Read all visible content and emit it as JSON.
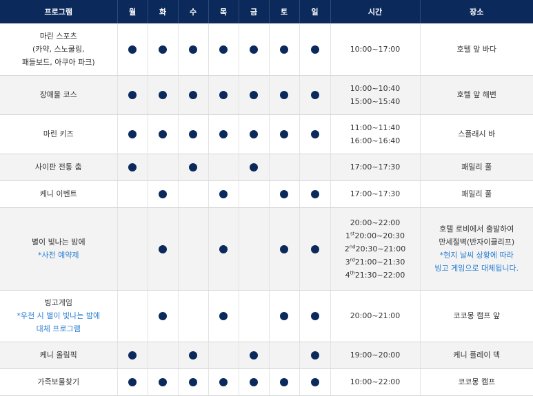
{
  "headers": {
    "program": "프로그램",
    "days": [
      "월",
      "화",
      "수",
      "목",
      "금",
      "토",
      "일"
    ],
    "time": "시간",
    "location": "장소"
  },
  "colors": {
    "header_bg": "#0b2a5b",
    "dot": "#0b2a5b",
    "note": "#2a7fd3",
    "alt_row": "#f3f3f3"
  },
  "rows": [
    {
      "program": [
        "마린 스포츠",
        "(카약, 스노쿨링,",
        "패들보드, 아쿠아 파크)"
      ],
      "program_note": [],
      "days": [
        true,
        true,
        true,
        true,
        true,
        true,
        true
      ],
      "times": [
        {
          "sup": "",
          "text": "10:00~17:00"
        }
      ],
      "location": [
        "호텔 앞 바다"
      ],
      "location_note": []
    },
    {
      "program": [
        "장애물 코스"
      ],
      "program_note": [],
      "days": [
        true,
        true,
        true,
        true,
        true,
        true,
        true
      ],
      "times": [
        {
          "sup": "",
          "text": "10:00~10:40"
        },
        {
          "sup": "",
          "text": "15:00~15:40"
        }
      ],
      "location": [
        "호텔 앞 해변"
      ],
      "location_note": []
    },
    {
      "program": [
        "마린 키즈"
      ],
      "program_note": [],
      "days": [
        true,
        true,
        true,
        true,
        true,
        true,
        true
      ],
      "times": [
        {
          "sup": "",
          "text": "11:00~11:40"
        },
        {
          "sup": "",
          "text": "16:00~16:40"
        }
      ],
      "location": [
        "스플래시 바"
      ],
      "location_note": []
    },
    {
      "program": [
        "사이판 전통 춤"
      ],
      "program_note": [],
      "days": [
        true,
        false,
        true,
        false,
        true,
        false,
        false
      ],
      "times": [
        {
          "sup": "",
          "text": "17:00~17:30"
        }
      ],
      "location": [
        "패밀리 풀"
      ],
      "location_note": []
    },
    {
      "program": [
        "케니 이벤트"
      ],
      "program_note": [],
      "days": [
        false,
        true,
        false,
        true,
        false,
        true,
        true
      ],
      "times": [
        {
          "sup": "",
          "text": "17:00~17:30"
        }
      ],
      "location": [
        "패밀리 풀"
      ],
      "location_note": []
    },
    {
      "program": [
        "별이 빛나는 밤에"
      ],
      "program_note": [
        "*사전 예약제"
      ],
      "days": [
        false,
        true,
        false,
        true,
        false,
        true,
        true
      ],
      "times": [
        {
          "prefix": "",
          "sup": "",
          "text": "20:00~22:00"
        },
        {
          "prefix": "1",
          "sup": "st",
          "text": "20:00~20:30"
        },
        {
          "prefix": "2",
          "sup": "nd",
          "text": "20:30~21:00"
        },
        {
          "prefix": "3",
          "sup": "rd",
          "text": "21:00~21:30"
        },
        {
          "prefix": "4",
          "sup": "th",
          "text": "21:30~22:00"
        }
      ],
      "location": [
        "호텔 로비에서 출발하여",
        "만세절벽(반자이클리프)"
      ],
      "location_note": [
        "*현지 날씨 상황에 따라",
        "빙고 게임으로 대체됩니다."
      ]
    },
    {
      "program": [
        "빙고게임"
      ],
      "program_note": [
        "*우천 시 별이 빛나는 밤에",
        "대체 프로그램"
      ],
      "days": [
        false,
        true,
        false,
        true,
        false,
        true,
        true
      ],
      "times": [
        {
          "sup": "",
          "text": "20:00~21:00"
        }
      ],
      "location": [
        "코코몽 캠프 앞"
      ],
      "location_note": []
    },
    {
      "program": [
        "케니 올림픽"
      ],
      "program_note": [],
      "days": [
        true,
        false,
        true,
        false,
        true,
        false,
        true
      ],
      "times": [
        {
          "sup": "",
          "text": "19:00~20:00"
        }
      ],
      "location": [
        "케니 플레이 덱"
      ],
      "location_note": []
    },
    {
      "program": [
        "가족보물찾기"
      ],
      "program_note": [],
      "days": [
        true,
        true,
        true,
        true,
        true,
        true,
        true
      ],
      "times": [
        {
          "sup": "",
          "text": "10:00~22:00"
        }
      ],
      "location": [
        "코코몽 캠프"
      ],
      "location_note": []
    }
  ]
}
